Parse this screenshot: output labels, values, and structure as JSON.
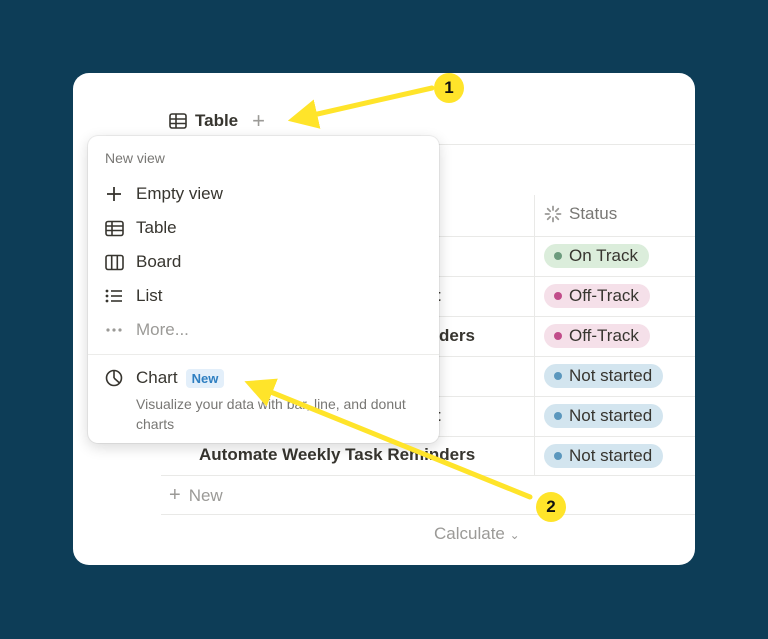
{
  "colors": {
    "background": "#0d3d57",
    "annotation": "#ffe42a",
    "on_track_bg": "#dbeddb",
    "on_track_dot": "#6c9b7d",
    "off_track_bg": "#f5e0e9",
    "off_track_dot": "#c14c8a",
    "not_started_bg": "#d3e5ef",
    "not_started_dot": "#5b97bd"
  },
  "table": {
    "tab_icon": "table-icon",
    "tab_label": "Table",
    "add_view_icon": "plus-icon",
    "status_header": "Status",
    "rows": [
      {
        "name": "",
        "status": "On Track",
        "status_type": "on_track"
      },
      {
        "name": "t",
        "status": "Off-Track",
        "status_type": "off_track"
      },
      {
        "name": "ders",
        "status": "Off-Track",
        "status_type": "off_track"
      },
      {
        "name": "",
        "status": "Not started",
        "status_type": "not_started"
      },
      {
        "name": "t",
        "status": "Not started",
        "status_type": "not_started"
      },
      {
        "name": "Automate Weekly Task Reminders",
        "status": "Not started",
        "status_type": "not_started"
      }
    ],
    "new_label": "New",
    "calculate_label": "Calculate"
  },
  "menu": {
    "header": "New view",
    "items": [
      {
        "label": "Empty view",
        "icon": "plus-icon"
      },
      {
        "label": "Table",
        "icon": "table-icon"
      },
      {
        "label": "Board",
        "icon": "board-icon"
      },
      {
        "label": "List",
        "icon": "list-icon"
      },
      {
        "label": "More...",
        "icon": "more-icon"
      }
    ],
    "chart": {
      "label": "Chart",
      "badge": "New",
      "icon": "chart-pie-icon",
      "description": "Visualize your data with bar, line, and donut charts"
    }
  },
  "annotations": [
    {
      "number": "1"
    },
    {
      "number": "2"
    }
  ]
}
